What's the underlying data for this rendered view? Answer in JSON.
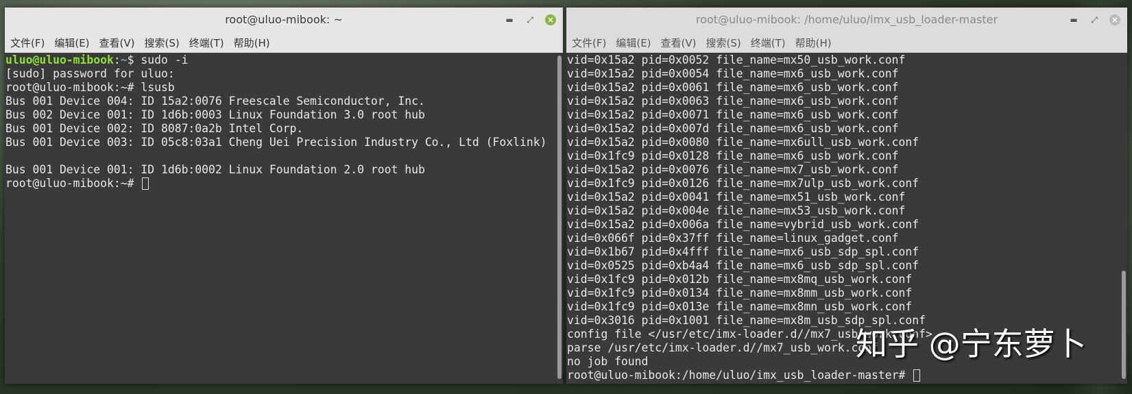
{
  "left_window": {
    "title": "root@uluo-mibook: ~",
    "menu": [
      "文件(F)",
      "编辑(E)",
      "查看(V)",
      "搜索(S)",
      "终端(T)",
      "帮助(H)"
    ],
    "prompt_user": "uluo@uluo-mibook",
    "prompt_path": "~",
    "lines": [
      {
        "user_prompt": true,
        "cmd": "$ sudo -i"
      },
      {
        "text": "[sudo] password for uluo:"
      },
      {
        "text": "root@uluo-mibook:~# lsusb"
      },
      {
        "text": "Bus 001 Device 004: ID 15a2:0076 Freescale Semiconductor, Inc."
      },
      {
        "text": "Bus 002 Device 001: ID 1d6b:0003 Linux Foundation 3.0 root hub"
      },
      {
        "text": "Bus 001 Device 002: ID 8087:0a2b Intel Corp."
      },
      {
        "text": "Bus 001 Device 003: ID 05c8:03a1 Cheng Uei Precision Industry Co., Ltd (Foxlink)"
      },
      {
        "text": ""
      },
      {
        "text": "Bus 001 Device 001: ID 1d6b:0002 Linux Foundation 2.0 root hub"
      },
      {
        "text": "root@uluo-mibook:~# ",
        "cursor": true
      }
    ]
  },
  "right_window": {
    "title": "root@uluo-mibook: /home/uluo/imx_usb_loader-master",
    "menu": [
      "文件(F)",
      "编辑(E)",
      "查看(V)",
      "搜索(S)",
      "终端(T)",
      "帮助(H)"
    ],
    "lines": [
      "vid=0x15a2 pid=0x0052 file_name=mx50_usb_work.conf",
      "vid=0x15a2 pid=0x0054 file_name=mx6_usb_work.conf",
      "vid=0x15a2 pid=0x0061 file_name=mx6_usb_work.conf",
      "vid=0x15a2 pid=0x0063 file_name=mx6_usb_work.conf",
      "vid=0x15a2 pid=0x0071 file_name=mx6_usb_work.conf",
      "vid=0x15a2 pid=0x007d file_name=mx6_usb_work.conf",
      "vid=0x15a2 pid=0x0080 file_name=mx6ull_usb_work.conf",
      "vid=0x1fc9 pid=0x0128 file_name=mx6_usb_work.conf",
      "vid=0x15a2 pid=0x0076 file_name=mx7_usb_work.conf",
      "vid=0x1fc9 pid=0x0126 file_name=mx7ulp_usb_work.conf",
      "vid=0x15a2 pid=0x0041 file_name=mx51_usb_work.conf",
      "vid=0x15a2 pid=0x004e file_name=mx53_usb_work.conf",
      "vid=0x15a2 pid=0x006a file_name=vybrid_usb_work.conf",
      "vid=0x066f pid=0x37ff file_name=linux_gadget.conf",
      "vid=0x1b67 pid=0x4fff file_name=mx6_usb_sdp_spl.conf",
      "vid=0x0525 pid=0xb4a4 file_name=mx6_usb_sdp_spl.conf",
      "vid=0x1fc9 pid=0x012b file_name=mx8mq_usb_work.conf",
      "vid=0x1fc9 pid=0x0134 file_name=mx8mm_usb_work.conf",
      "vid=0x1fc9 pid=0x013e file_name=mx8mn_usb_work.conf",
      "vid=0x3016 pid=0x1001 file_name=mx8m_usb_sdp_spl.conf",
      "config file </usr/etc/imx-loader.d//mx7_usb_work.conf>",
      "parse /usr/etc/imx-loader.d//mx7_usb_work.conf",
      "no job found"
    ],
    "prompt": "root@uluo-mibook:/home/uluo/imx_usb_loader-master# "
  },
  "watermark": "知乎 @宁东萝卜"
}
